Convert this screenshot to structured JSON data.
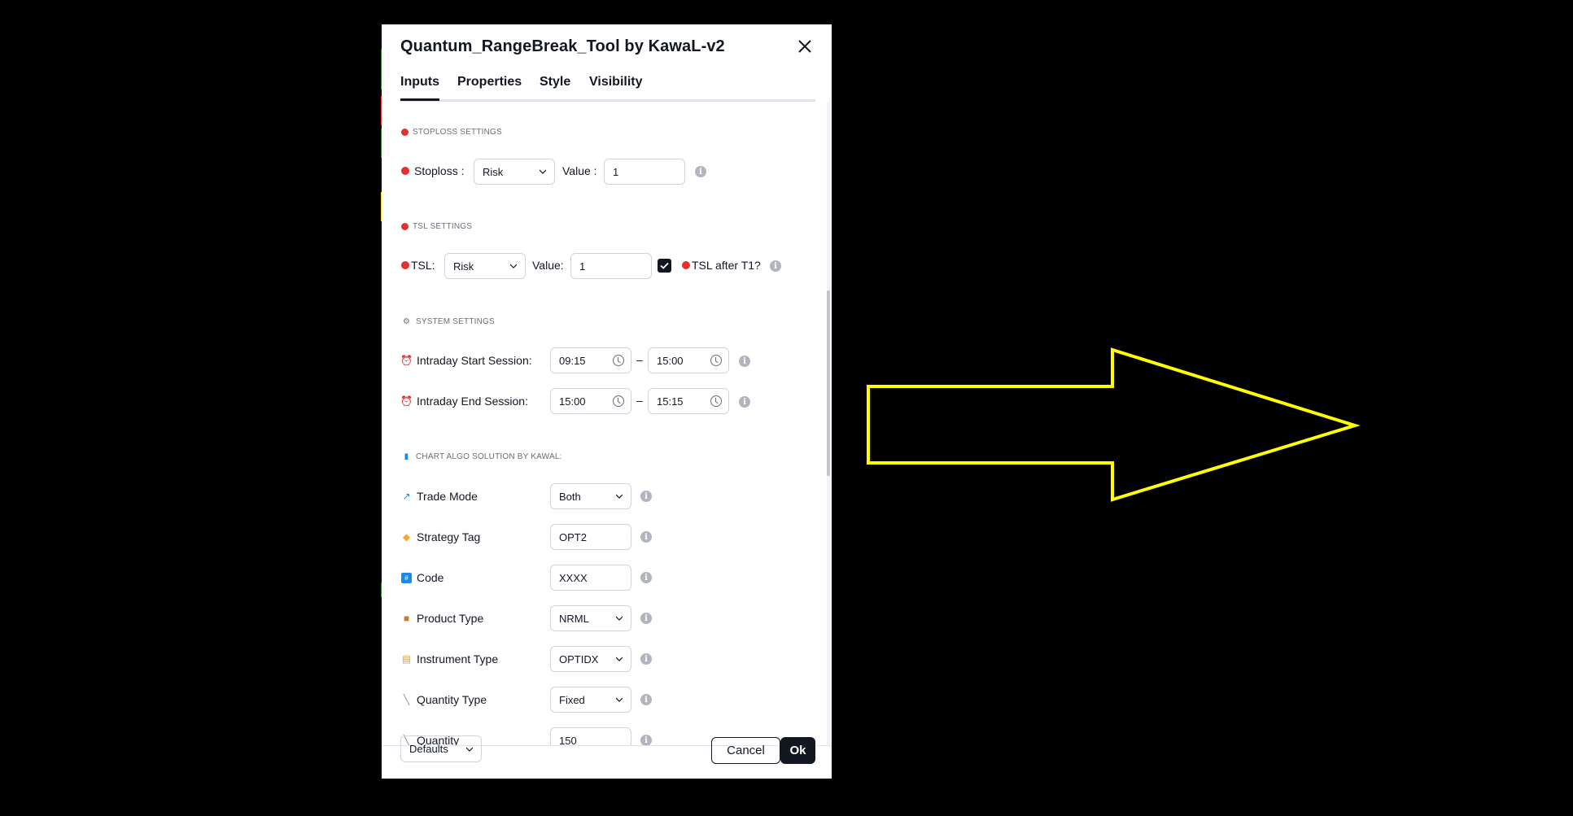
{
  "dialog": {
    "title": "Quantum_RangeBreak_Tool by KawaL-v2",
    "tabs": [
      {
        "label": "Inputs",
        "active": true
      },
      {
        "label": "Properties",
        "active": false
      },
      {
        "label": "Style",
        "active": false
      },
      {
        "label": "Visibility",
        "active": false
      }
    ]
  },
  "stoploss": {
    "section": "STOPLOSS SETTINGS",
    "label": "Stoploss :",
    "type_value": "Risk",
    "value_label": "Value :",
    "value": "1"
  },
  "tsl": {
    "section": "TSL SETTINGS",
    "label": "TSL:",
    "type_value": "Risk",
    "value_label": "Value:",
    "value": "1",
    "after_t1_label": "TSL after T1?",
    "after_t1_checked": true
  },
  "system": {
    "section": "SYSTEM SETTINGS",
    "start_label": "Intraday Start Session:",
    "start_from": "09:15",
    "start_to": "15:00",
    "end_label": "Intraday End Session:",
    "end_from": "15:00",
    "end_to": "15:15",
    "dash": "–"
  },
  "algo": {
    "section": "CHART ALGO SOLUTION BY KAWAL:",
    "trade_mode_label": "Trade Mode",
    "trade_mode_value": "Both",
    "strategy_tag_label": "Strategy Tag",
    "strategy_tag_value": "OPT2",
    "code_label": "Code",
    "code_value": "XXXX",
    "product_type_label": "Product Type",
    "product_type_value": "NRML",
    "instrument_type_label": "Instrument Type",
    "instrument_type_value": "OPTIDX",
    "quantity_type_label": "Quantity Type",
    "quantity_type_value": "Fixed",
    "quantity_label": "Quantity",
    "quantity_value": "150"
  },
  "footer": {
    "defaults_label": "Defaults",
    "cancel_label": "Cancel",
    "ok_label": "Ok"
  },
  "colors": {
    "accent": "#131722",
    "red_dot": "#e5302e",
    "arrow": "#ffff00"
  }
}
